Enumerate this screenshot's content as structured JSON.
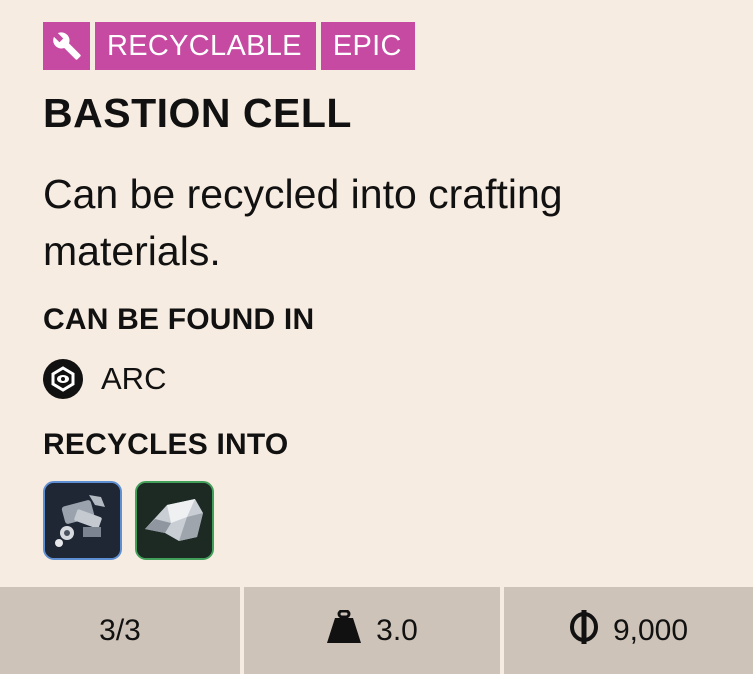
{
  "tags": {
    "icon": "wrench-icon",
    "category": "RECYCLABLE",
    "rarity": "EPIC",
    "color": "#c64aa1"
  },
  "item": {
    "name": "BASTION CELL",
    "description": "Can be recycled into crafting materials."
  },
  "found_in": {
    "heading": "CAN BE FOUND IN",
    "sources": [
      {
        "icon": "arc-icon",
        "label": "ARC"
      }
    ]
  },
  "recycles_into": {
    "heading": "RECYCLES INTO",
    "materials": [
      {
        "icon": "mechanical-parts-icon",
        "border_color": "#5f8fd3"
      },
      {
        "icon": "metal-alloy-icon",
        "border_color": "#43a05a"
      }
    ]
  },
  "stats": {
    "stack": "3/3",
    "weight_icon": "weight-icon",
    "weight": "3.0",
    "value_icon": "coin-icon",
    "value": "9,000"
  }
}
